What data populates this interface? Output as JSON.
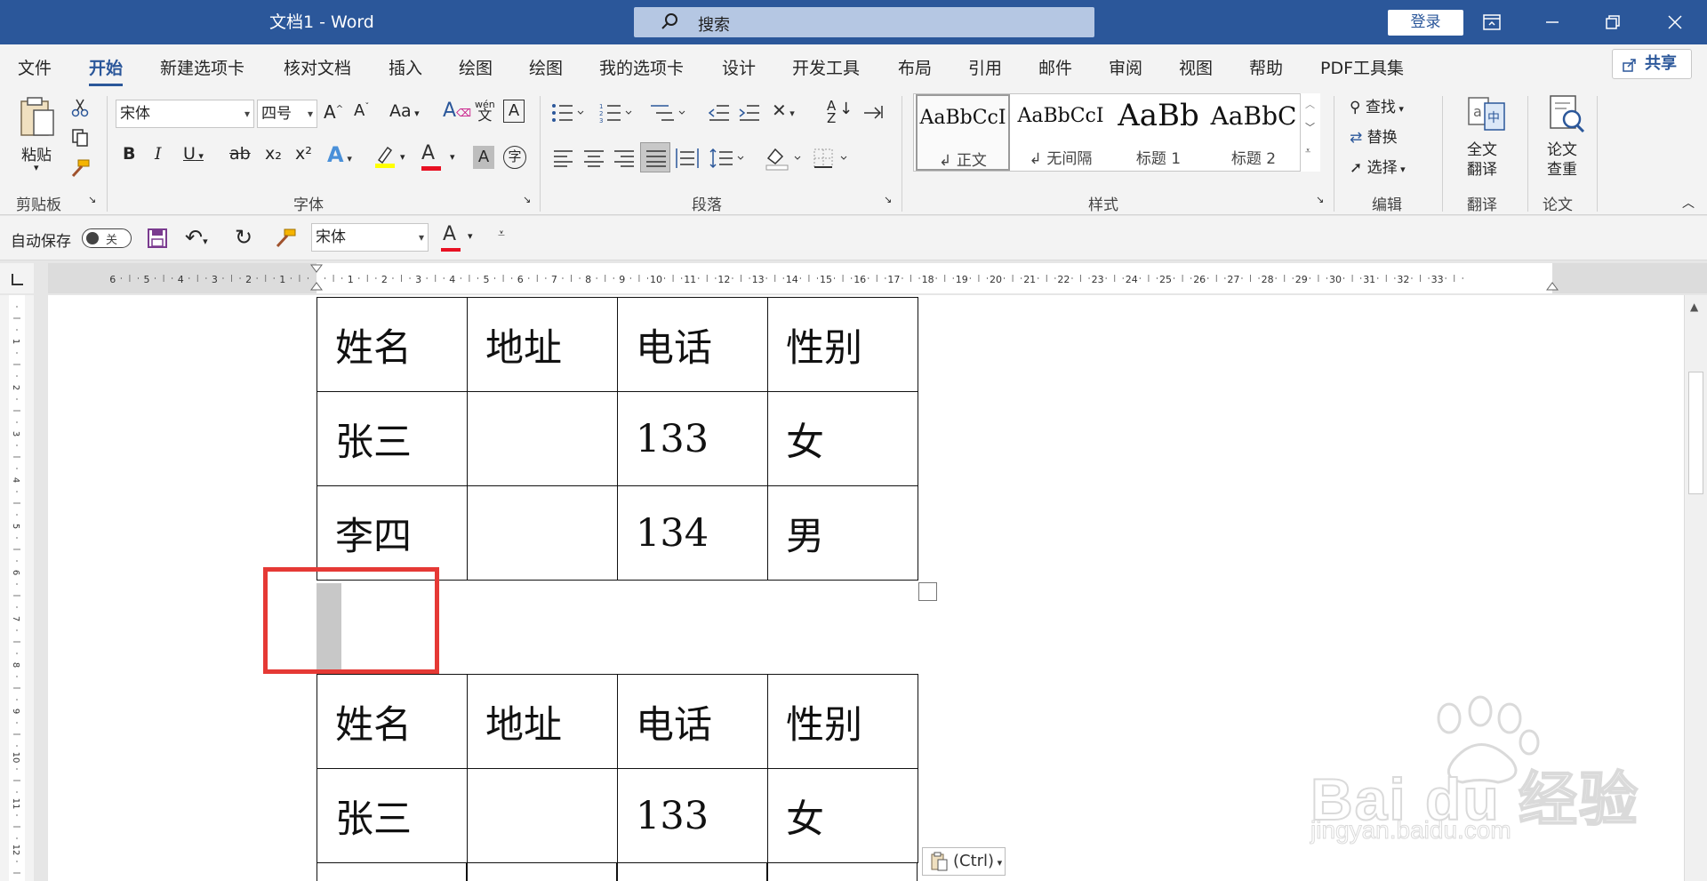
{
  "titlebar": {
    "title": "文档1  -  Word",
    "search_placeholder": "搜索",
    "login_label": "登录",
    "window_controls": [
      "ribbon-display-icon",
      "minimize-icon",
      "restore-icon",
      "close-icon"
    ]
  },
  "menu": {
    "tabs": [
      "文件",
      "开始",
      "新建选项卡",
      "核对文档",
      "插入",
      "绘图",
      "绘图",
      "我的选项卡",
      "设计",
      "开发工具",
      "布局",
      "引用",
      "邮件",
      "审阅",
      "视图",
      "帮助",
      "PDF工具集"
    ],
    "active_tab": "开始",
    "share_label": "共享"
  },
  "ribbon": {
    "clipboard": {
      "paste_label": "粘贴",
      "group_label": "剪贴板"
    },
    "font": {
      "font_name": "宋体",
      "font_size": "四号",
      "group_label": "字体",
      "bold": "B",
      "italic": "I",
      "underline": "U",
      "strike": "ab",
      "subscript": "x₂",
      "superscript": "x²",
      "grow_font": "A",
      "shrink_font": "A",
      "change_case": "Aa",
      "phonetic": "wén",
      "char_border": "A",
      "char_shading": "A",
      "enclose": "字",
      "font_color_accent": "#e81123",
      "highlight_accent": "#ffff00"
    },
    "paragraph": {
      "group_label": "段落"
    },
    "styles": {
      "group_label": "样式",
      "items": [
        {
          "sample": "AaBbCcI",
          "name": "↲ 正文"
        },
        {
          "sample": "AaBbCcI",
          "name": "↲ 无间隔"
        },
        {
          "sample": "AaBb",
          "name": "标题 1"
        },
        {
          "sample": "AaBbC",
          "name": "标题 2"
        }
      ]
    },
    "editing": {
      "find": "查找",
      "replace": "替换",
      "select": "选择",
      "group_label": "编辑"
    },
    "translate": {
      "button_line1": "全文",
      "button_line2": "翻译",
      "group_label": "翻译"
    },
    "paper": {
      "button_line1": "论文",
      "button_line2": "查重",
      "group_label": "论文"
    }
  },
  "qat": {
    "autosave_label": "自动保存",
    "autosave_state": "关",
    "font_name": "宋体",
    "font_color_label": "A"
  },
  "ruler": {
    "h_numbers_left": [
      "6",
      "5",
      "4",
      "3",
      "2",
      "1"
    ],
    "h_numbers_right": [
      "1",
      "2",
      "3",
      "4",
      "5",
      "6",
      "7",
      "8",
      "9",
      "10",
      "11",
      "12",
      "13",
      "14",
      "15",
      "16",
      "17",
      "18",
      "19",
      "20",
      "21",
      "22",
      "23",
      "24",
      "25",
      "26",
      "27",
      "28",
      "29",
      "30",
      "31",
      "32",
      "33"
    ],
    "v_numbers": [
      "1",
      "2",
      "3",
      "4",
      "5",
      "6",
      "7",
      "8",
      "9",
      "10",
      "11",
      "12"
    ]
  },
  "document": {
    "table1": [
      [
        "姓名",
        "地址",
        "电话",
        "性别"
      ],
      [
        "张三",
        "",
        "133",
        "女"
      ],
      [
        "李四",
        "",
        "134",
        "男"
      ]
    ],
    "table2": [
      [
        "姓名",
        "地址",
        "电话",
        "性别"
      ],
      [
        "张三",
        "",
        "133",
        "女"
      ],
      [
        "",
        "",
        "",
        ""
      ]
    ],
    "paste_options_label": "(Ctrl)"
  },
  "watermark": {
    "brand": "Bai du 经验",
    "url": "jingyan.baidu.com"
  },
  "colors": {
    "accent": "#2b579a",
    "highlight_box": "#e53935"
  }
}
